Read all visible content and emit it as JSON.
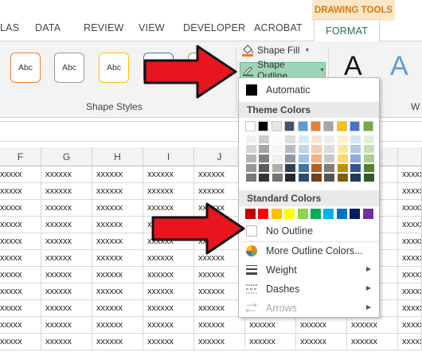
{
  "tabs": {
    "context_group": "DRAWING TOOLS",
    "items": [
      "LAS",
      "DATA",
      "REVIEW",
      "VIEW",
      "DEVELOPER",
      "ACROBAT"
    ],
    "active": "FORMAT"
  },
  "ribbon": {
    "shape_styles": {
      "label": "Shape Styles",
      "presets": [
        "Abc",
        "Abc",
        "Abc"
      ]
    },
    "shape_fill_label": "Shape Fill",
    "shape_outline_label": "Shape Outline",
    "wordart_glyphs": [
      "A",
      "A"
    ],
    "partial_group_label": "W"
  },
  "columns": [
    "F",
    "G",
    "H",
    "I",
    "J"
  ],
  "cell_text": "xxxxxx",
  "menu": {
    "automatic": "Automatic",
    "theme_colors_heading": "Theme Colors",
    "theme_colors": [
      "#ffffff",
      "#000000",
      "#e7e6e6",
      "#44546a",
      "#5b9bd5",
      "#ed7d31",
      "#a5a5a5",
      "#ffc000",
      "#4472c4",
      "#70ad47"
    ],
    "standard_colors_heading": "Standard Colors",
    "standard_colors": [
      "#c00000",
      "#ff0000",
      "#ffc000",
      "#ffff00",
      "#92d050",
      "#00b050",
      "#00b0f0",
      "#0070c0",
      "#002060",
      "#7030a0"
    ],
    "no_outline": "No Outline",
    "more_colors": "More Outline Colors...",
    "weight": "Weight",
    "dashes": "Dashes",
    "arrows": "Arrows"
  },
  "colors": {
    "accent": "#217346",
    "arrow": "#e8141e",
    "context": "#d6791a",
    "highlight": "#9fd5b7"
  }
}
